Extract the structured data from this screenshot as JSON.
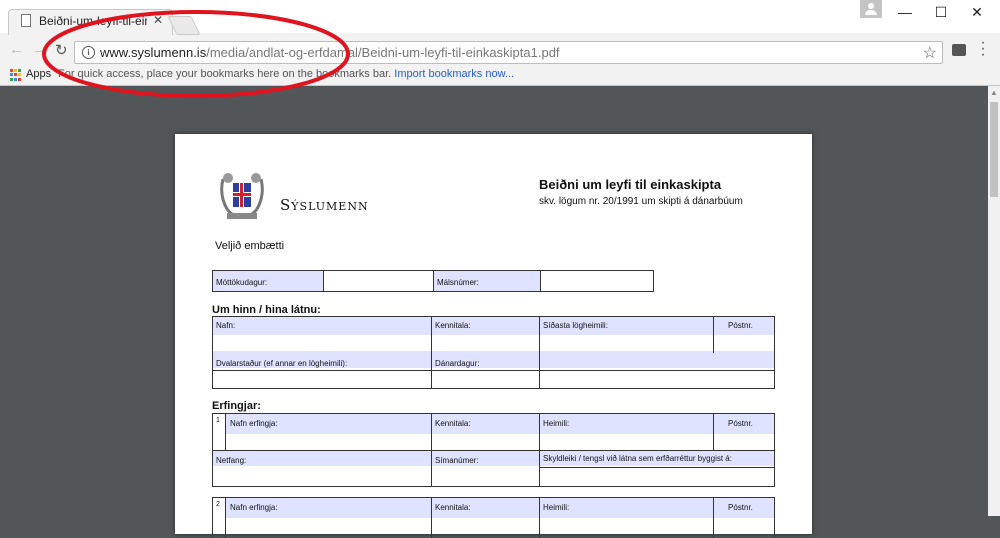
{
  "browser": {
    "tab_title": "Beiðni-um-leyfi-til-einkas",
    "url_domain": "www.syslumenn.is",
    "url_path": "/media/andlat-og-erfdamal/Beidni-um-leyfi-til-einkaskipta1.pdf",
    "apps_label": "Apps",
    "bookmarks_hint": "For quick access, place your bookmarks here on the bookmarks bar.",
    "import_link": "Import bookmarks now..."
  },
  "document": {
    "org_name": "Sýslumenn",
    "title": "Beiðni um leyfi til einkaskipta",
    "subtitle": "skv. lögum nr. 20/1991 um skipti á dánarbúum",
    "select_office": "Veljið embætti",
    "receipt": {
      "received_label": "Móttökudagur:",
      "case_label": "Málsnúmer:"
    },
    "deceased": {
      "heading": "Um hinn / hina látnu:",
      "name": "Nafn:",
      "kennitala": "Kennitala:",
      "last_domicile": "Síðasta lögheimili:",
      "postal": "Póstnr.",
      "residence": "Dvalarstaður (ef annar en lögheimili):",
      "date_of_death": "Dánardagur:"
    },
    "heirs": {
      "heading": "Erfingjar:",
      "entries": [
        {
          "number": "1",
          "name": "Nafn erfingja:",
          "kennitala": "Kennitala:",
          "home": "Heimili:",
          "postal": "Póstnr.",
          "email": "Netfang:",
          "phone": "Símanúmer:",
          "relation": "Skyldleiki / tengsl við látna sem erfðarréttur byggist á:"
        },
        {
          "number": "2",
          "name": "Nafn erfingja:",
          "kennitala": "Kennitala:",
          "home": "Heimili:",
          "postal": "Póstnr."
        }
      ]
    }
  },
  "colors": {
    "annotation": "#e0141e",
    "form_fill": "#dfe3ff",
    "viewer_bg": "#525659"
  }
}
